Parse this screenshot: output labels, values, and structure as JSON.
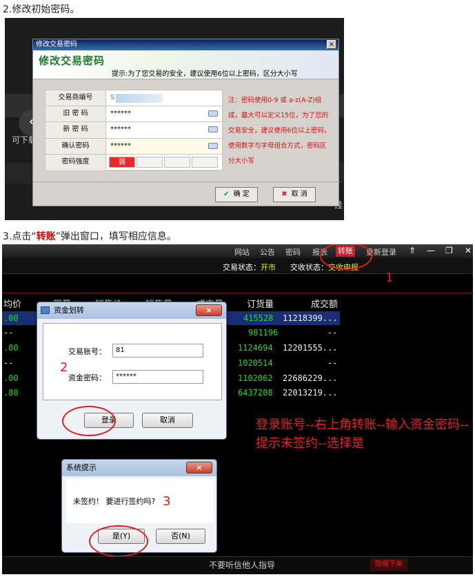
{
  "step2": {
    "heading": "2.修改初始密码。",
    "background": {
      "left_text": "可下载",
      "right_text": "挂",
      "nav_arrow": "‹"
    },
    "dialog": {
      "title": "修改交易密码",
      "banner_title": "修改交易密码",
      "tip": "提示:为了您交易的安全，建议使用6位以上密码，区分大小写",
      "close": "×",
      "fields": [
        {
          "label": "交易商编号",
          "value": "S"
        },
        {
          "label": "旧 密 码",
          "value": "******"
        },
        {
          "label": "新 密 码",
          "value": "******"
        },
        {
          "label": "确认密码",
          "value": "******"
        },
        {
          "label": "密码强度",
          "value": "弱"
        }
      ],
      "note": "注：密码使用0-9 或 a-z(A-Z)组成，最大可以定义15位，为了您的交易安全，建议使用6位以上密码，使用数字与字母组合方式，密码区分大小写",
      "ok_label": "确 定",
      "cancel_label": "取 消",
      "ok_icon": "✔",
      "cancel_icon": "✖"
    }
  },
  "step3": {
    "heading_prefix": "3.点击“",
    "heading_highlight": "转账",
    "heading_suffix": "”弹出窗口，填写相应信息。",
    "menu": [
      "网站",
      "公告",
      "密码",
      "报表",
      "转账",
      "重新登录"
    ],
    "active_menu": "转账",
    "window_icons": [
      "⇑",
      "—",
      "❐",
      "✕"
    ],
    "status": {
      "trade_label": "交易状态：",
      "trade_value": "开市",
      "deliver_label": "交收状态：",
      "deliver_value": "交收申报"
    },
    "columns": [
      "均价",
      "现量",
      "销售价",
      "销售量",
      "成交量",
      "订货量",
      "成交额"
    ],
    "rows": [
      {
        "avg": ".00",
        "order": "415528",
        "amount": "11218399..."
      },
      {
        "avg": "--",
        "order": "981196",
        "amount": "--"
      },
      {
        "avg": ".00",
        "order": "1124694",
        "amount": "12201555..."
      },
      {
        "avg": "--",
        "order": "1020514",
        "amount": "--"
      },
      {
        "avg": ".00",
        "order": "1102062",
        "amount": "22686229..."
      },
      {
        "avg": ".80",
        "order": "6437208",
        "amount": "22013219..."
      }
    ],
    "instruction": "登录账号--右上角转账--输入资金密码--提示未签约--选择是",
    "bottom_text": "不要听信他人指导",
    "hide_order": "隐藏下单",
    "marker_numbers": [
      "1",
      "2",
      "3"
    ],
    "transfer_dialog": {
      "title": "资金划转",
      "close": "×",
      "account_label": "交易账号：",
      "account_value": "81",
      "password_label": "资金密码：",
      "password_value": "******",
      "login_label": "登录",
      "cancel_label": "取消"
    },
    "prompt_dialog": {
      "title": "系统提示",
      "close": "×",
      "message": "未签约！ 要进行签约吗?",
      "yes_label": "是(Y)",
      "no_label": "否(N)"
    }
  }
}
